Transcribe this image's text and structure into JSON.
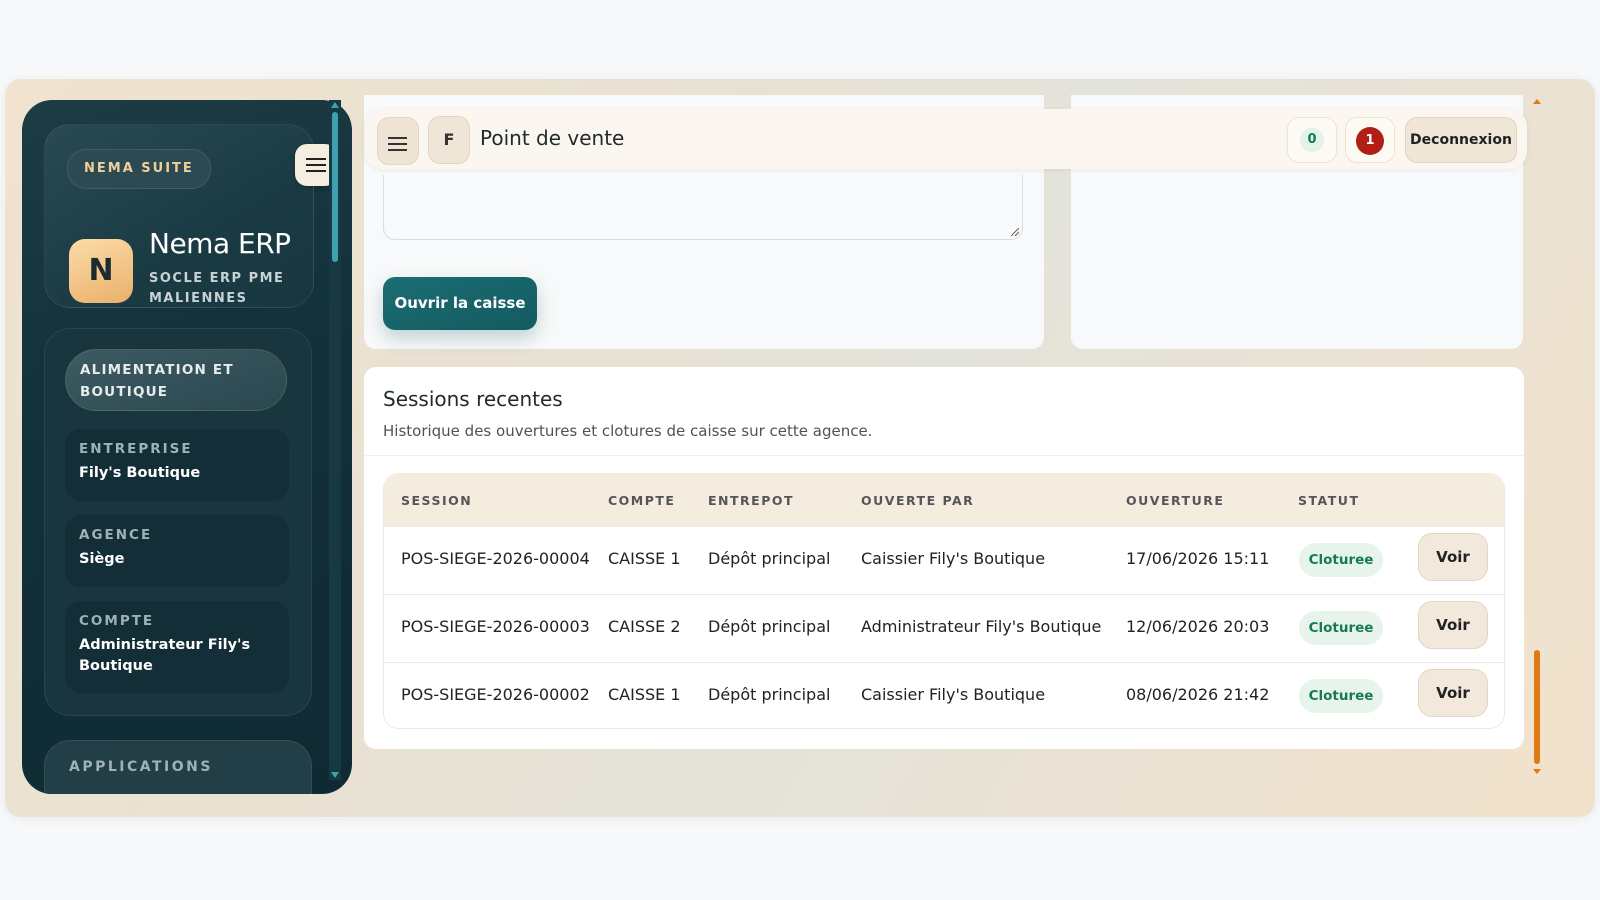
{
  "sidebar": {
    "brand_tag": "NEMA SUITE",
    "logo_letter": "N",
    "brand_name": "Nema ERP",
    "brand_subtitle": "SOCLE ERP PME MALIENNES",
    "sector": "ALIMENTATION ET BOUTIQUE",
    "entreprise": {
      "label": "ENTREPRISE",
      "value": "Fily's Boutique"
    },
    "agence": {
      "label": "AGENCE",
      "value": "Siège"
    },
    "compte": {
      "label": "COMPTE",
      "value": "Administrateur Fily's Boutique"
    },
    "apps_label": "APPLICATIONS",
    "menu_icon": "hamburger-icon"
  },
  "topbar": {
    "menu_icon": "hamburger-icon",
    "avatar_letter": "F",
    "title": "Point de vente",
    "badge_green": "0",
    "badge_red": "1",
    "logout_label": "Deconnexion"
  },
  "form": {
    "open_button": "Ouvrir la caisse"
  },
  "sessions": {
    "title": "Sessions recentes",
    "subtitle": "Historique des ouvertures et clotures de caisse sur cette agence.",
    "columns": [
      "SESSION",
      "COMPTE",
      "ENTREPOT",
      "OUVERTE PAR",
      "OUVERTURE",
      "STATUT"
    ],
    "rows": [
      {
        "session": "POS-SIEGE-2026-00004",
        "compte": "CAISSE 1",
        "entrepot": "Dépôt principal",
        "ouverte_par": "Caissier Fily's Boutique",
        "ouverture": "17/06/2026 15:11",
        "statut": "Cloturee",
        "action": "Voir"
      },
      {
        "session": "POS-SIEGE-2026-00003",
        "compte": "CAISSE 2",
        "entrepot": "Dépôt principal",
        "ouverte_par": "Administrateur Fily's Boutique",
        "ouverture": "12/06/2026 20:03",
        "statut": "Cloturee",
        "action": "Voir"
      },
      {
        "session": "POS-SIEGE-2026-00002",
        "compte": "CAISSE 1",
        "entrepot": "Dépôt principal",
        "ouverte_par": "Caissier Fily's Boutique",
        "ouverture": "08/06/2026 21:42",
        "statut": "Cloturee",
        "action": "Voir"
      }
    ]
  },
  "colors": {
    "accent_teal": "#125a60",
    "sidebar_bg": "#12313b",
    "status_green": "#177a55",
    "alert_red": "#b01e16",
    "scroll_orange": "#e07a12"
  }
}
